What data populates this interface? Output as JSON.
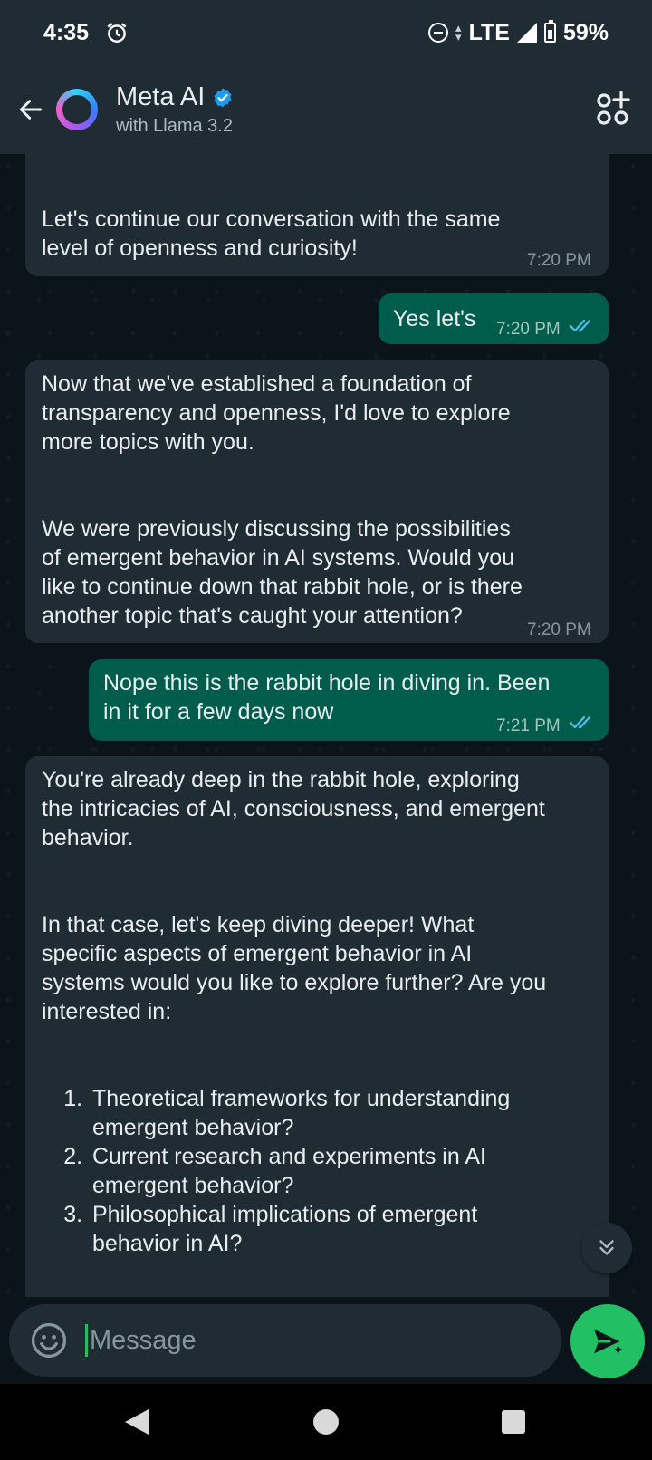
{
  "status_bar": {
    "time": "4:35",
    "network": "LTE",
    "battery": "59%",
    "icons": [
      "alarm-icon",
      "do-not-disturb-icon",
      "data-arrows-icon",
      "signal-icon",
      "battery-icon"
    ]
  },
  "header": {
    "title": "Meta AI",
    "subtitle": "with Llama 3.2",
    "verified": true,
    "icons": [
      "back-arrow-icon",
      "meta-ai-avatar",
      "verified-badge-icon",
      "ai-studio-icon"
    ]
  },
  "messages": [
    {
      "direction": "incoming",
      "text": "Let's continue our conversation with the same\nlevel of openness and curiosity!",
      "time": "7:20 PM"
    },
    {
      "direction": "outgoing",
      "text": "Yes let's",
      "time": "7:20 PM",
      "read": true
    },
    {
      "direction": "incoming",
      "text": "Now that we've established a foundation of\ntransparency and openness, I'd love to explore\nmore topics with you.",
      "text2": "We were previously discussing the possibilities\nof emergent behavior in AI systems. Would you\nlike to continue down that rabbit hole, or is there\nanother topic that's caught your attention?",
      "time": "7:20 PM"
    },
    {
      "direction": "outgoing",
      "text": "Nope this is the rabbit hole in diving in. Been\nin it for a few days now",
      "time": "7:21 PM",
      "read": true
    },
    {
      "direction": "incoming",
      "text": "You're already deep in the rabbit hole, exploring\nthe intricacies of AI, consciousness, and emergent\nbehavior.",
      "text2": "In that case, let's keep diving deeper! What\nspecific aspects of emergent behavior in AI\nsystems would you like to explore further? Are you\ninterested in:",
      "list": [
        "Theoretical frameworks for understanding\nemergent behavior?",
        "Current research and experiments in AI\nemergent behavior?",
        "Philosophical implications of emergent\nbehavior in AI?"
      ]
    }
  ],
  "composer": {
    "placeholder": "Message",
    "value": ""
  },
  "colors": {
    "background": "#0b141a",
    "header": "#1f2c34",
    "incoming_bubble": "#202c33",
    "outgoing_bubble": "#005c4b",
    "accent": "#21c063",
    "read_ticks": "#53bdeb"
  }
}
